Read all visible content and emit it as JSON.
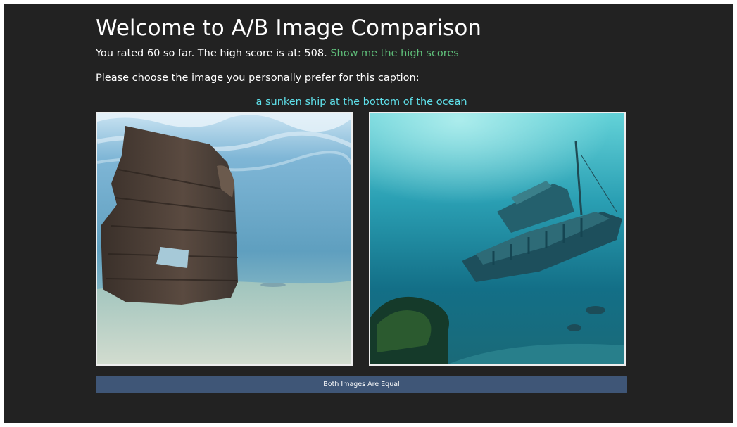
{
  "header": {
    "title": "Welcome to A/B Image Comparison",
    "score_text": "You rated 60 so far. The high score is at: 508.",
    "high_scores_link": "Show me the high scores"
  },
  "prompt": {
    "instruction": "Please choose the image you personally prefer for this caption:",
    "caption": "a sunken ship at the bottom of the ocean"
  },
  "actions": {
    "equal_button": "Both Images Are Equal"
  },
  "colors": {
    "background": "#222222",
    "link": "#5fbf7a",
    "caption": "#5fe0ea",
    "button": "#3f5677"
  }
}
